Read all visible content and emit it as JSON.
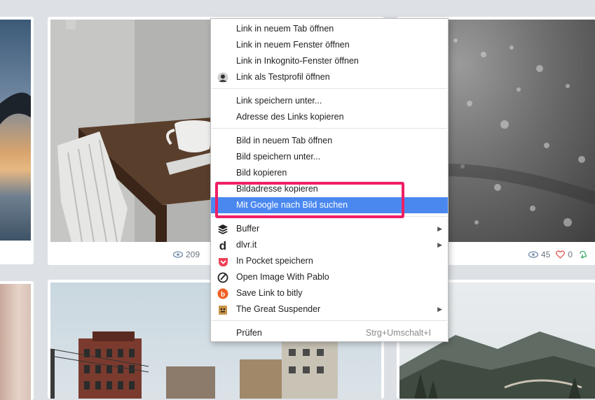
{
  "cards": {
    "middle_top": {
      "views": "209"
    },
    "right_top": {
      "views": "45",
      "likes": "0"
    }
  },
  "context_menu": {
    "items": [
      {
        "label": "Link in neuem Tab öffnen"
      },
      {
        "label": "Link in neuem Fenster öffnen"
      },
      {
        "label": "Link in Inkognito-Fenster öffnen"
      },
      {
        "label": "Link als Testprofil öffnen",
        "icon": "profile-avatar-icon"
      },
      {
        "label": "Link speichern unter..."
      },
      {
        "label": "Adresse des Links kopieren"
      },
      {
        "label": "Bild in neuem Tab öffnen"
      },
      {
        "label": "Bild speichern unter..."
      },
      {
        "label": "Bild kopieren"
      },
      {
        "label": "Bildadresse kopieren"
      },
      {
        "label": "Mit Google nach Bild suchen",
        "state": "highlighted"
      },
      {
        "label": "Buffer",
        "icon": "buffer-icon",
        "submenu": true
      },
      {
        "label": "dlvr.it",
        "icon": "dlvrit-icon",
        "submenu": true
      },
      {
        "label": "In Pocket speichern",
        "icon": "pocket-icon"
      },
      {
        "label": "Open Image With Pablo",
        "icon": "pablo-icon"
      },
      {
        "label": "Save Link to bitly",
        "icon": "bitly-icon"
      },
      {
        "label": "The Great Suspender",
        "icon": "suspender-icon",
        "submenu": true
      },
      {
        "label": "Prüfen",
        "shortcut": "Strg+Umschalt+I"
      }
    ]
  },
  "colors": {
    "background": "#dde1e6",
    "menu_highlight": "#4a88f0",
    "annotation_border": "#ef1e65",
    "pocket": "#ee4056",
    "bitly": "#ee6123"
  }
}
